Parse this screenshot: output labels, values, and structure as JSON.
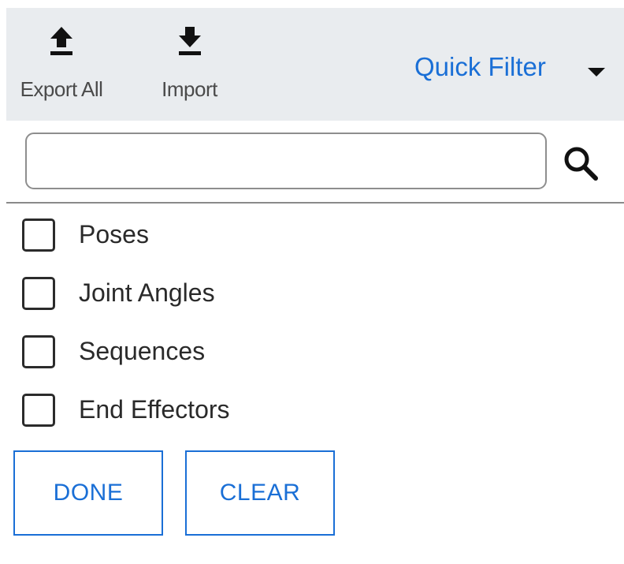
{
  "toolbar": {
    "export_all": {
      "label": "Export All",
      "icon": "upload-icon"
    },
    "import": {
      "label": "Import",
      "icon": "download-icon"
    },
    "quick_filter": {
      "label": "Quick Filter",
      "icon": "caret-down-icon"
    }
  },
  "search": {
    "value": "",
    "placeholder": "",
    "icon": "search-icon"
  },
  "filters": [
    {
      "label": "Poses",
      "checked": false
    },
    {
      "label": "Joint Angles",
      "checked": false
    },
    {
      "label": "Sequences",
      "checked": false
    },
    {
      "label": "End Effectors",
      "checked": false
    }
  ],
  "actions": {
    "done_label": "DONE",
    "clear_label": "CLEAR"
  },
  "colors": {
    "accent": "#1a6fd6",
    "toolbar_bg": "#e9ecef",
    "text": "#2a2a2a",
    "muted_text": "#4a4a4a"
  }
}
